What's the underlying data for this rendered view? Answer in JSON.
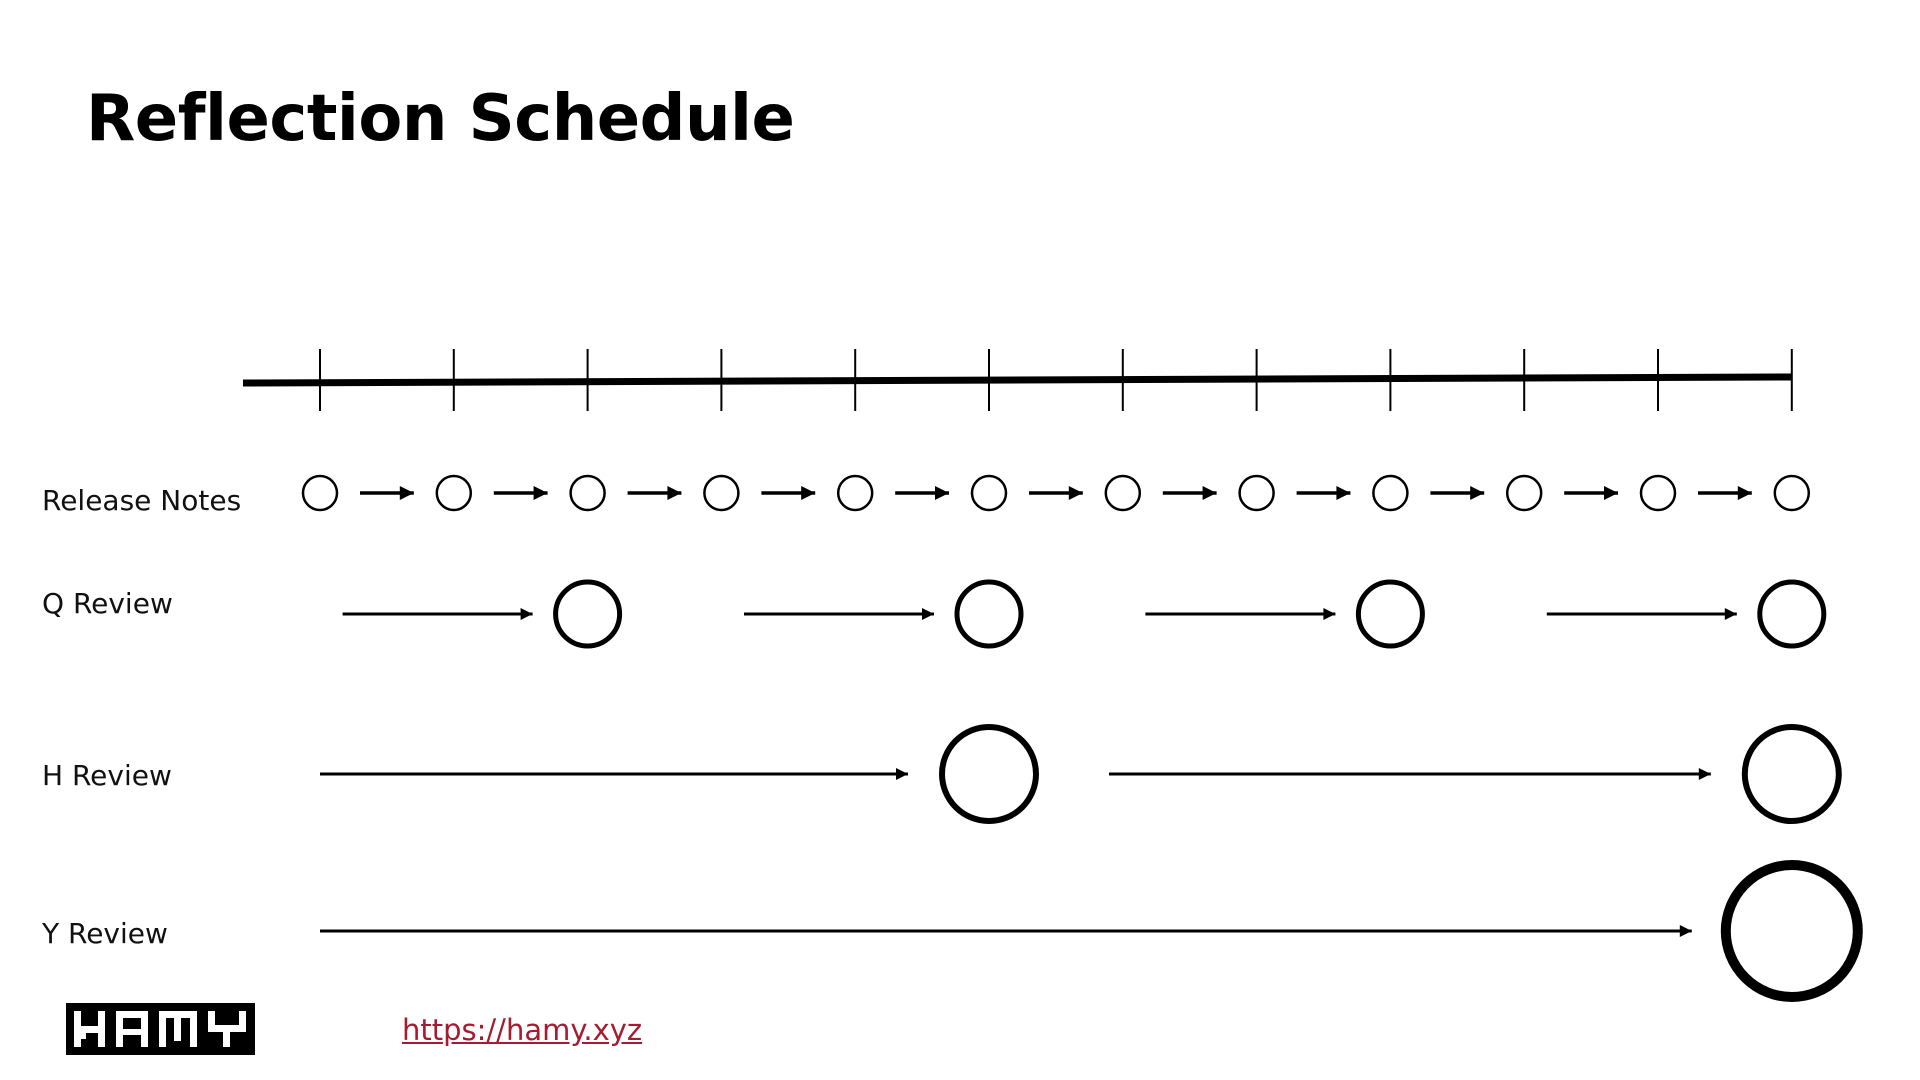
{
  "title": "Reflection Schedule",
  "timeline": {
    "tick_count": 12
  },
  "rows": [
    {
      "label": "Release Notes",
      "circles_at_ticks": [
        0,
        1,
        2,
        3,
        4,
        5,
        6,
        7,
        8,
        9,
        10,
        11
      ],
      "size": "small"
    },
    {
      "label": "Q Review",
      "circles_at_ticks": [
        2,
        5,
        8,
        11
      ],
      "size": "medium"
    },
    {
      "label": "H Review",
      "circles_at_ticks": [
        5,
        11
      ],
      "size": "large"
    },
    {
      "label": "Y Review",
      "circles_at_ticks": [
        11
      ],
      "size": "xlarge"
    }
  ],
  "footer": {
    "logo_text": "HAMY",
    "link": "https://hamy.xyz",
    "link_color": "#a51c30"
  }
}
